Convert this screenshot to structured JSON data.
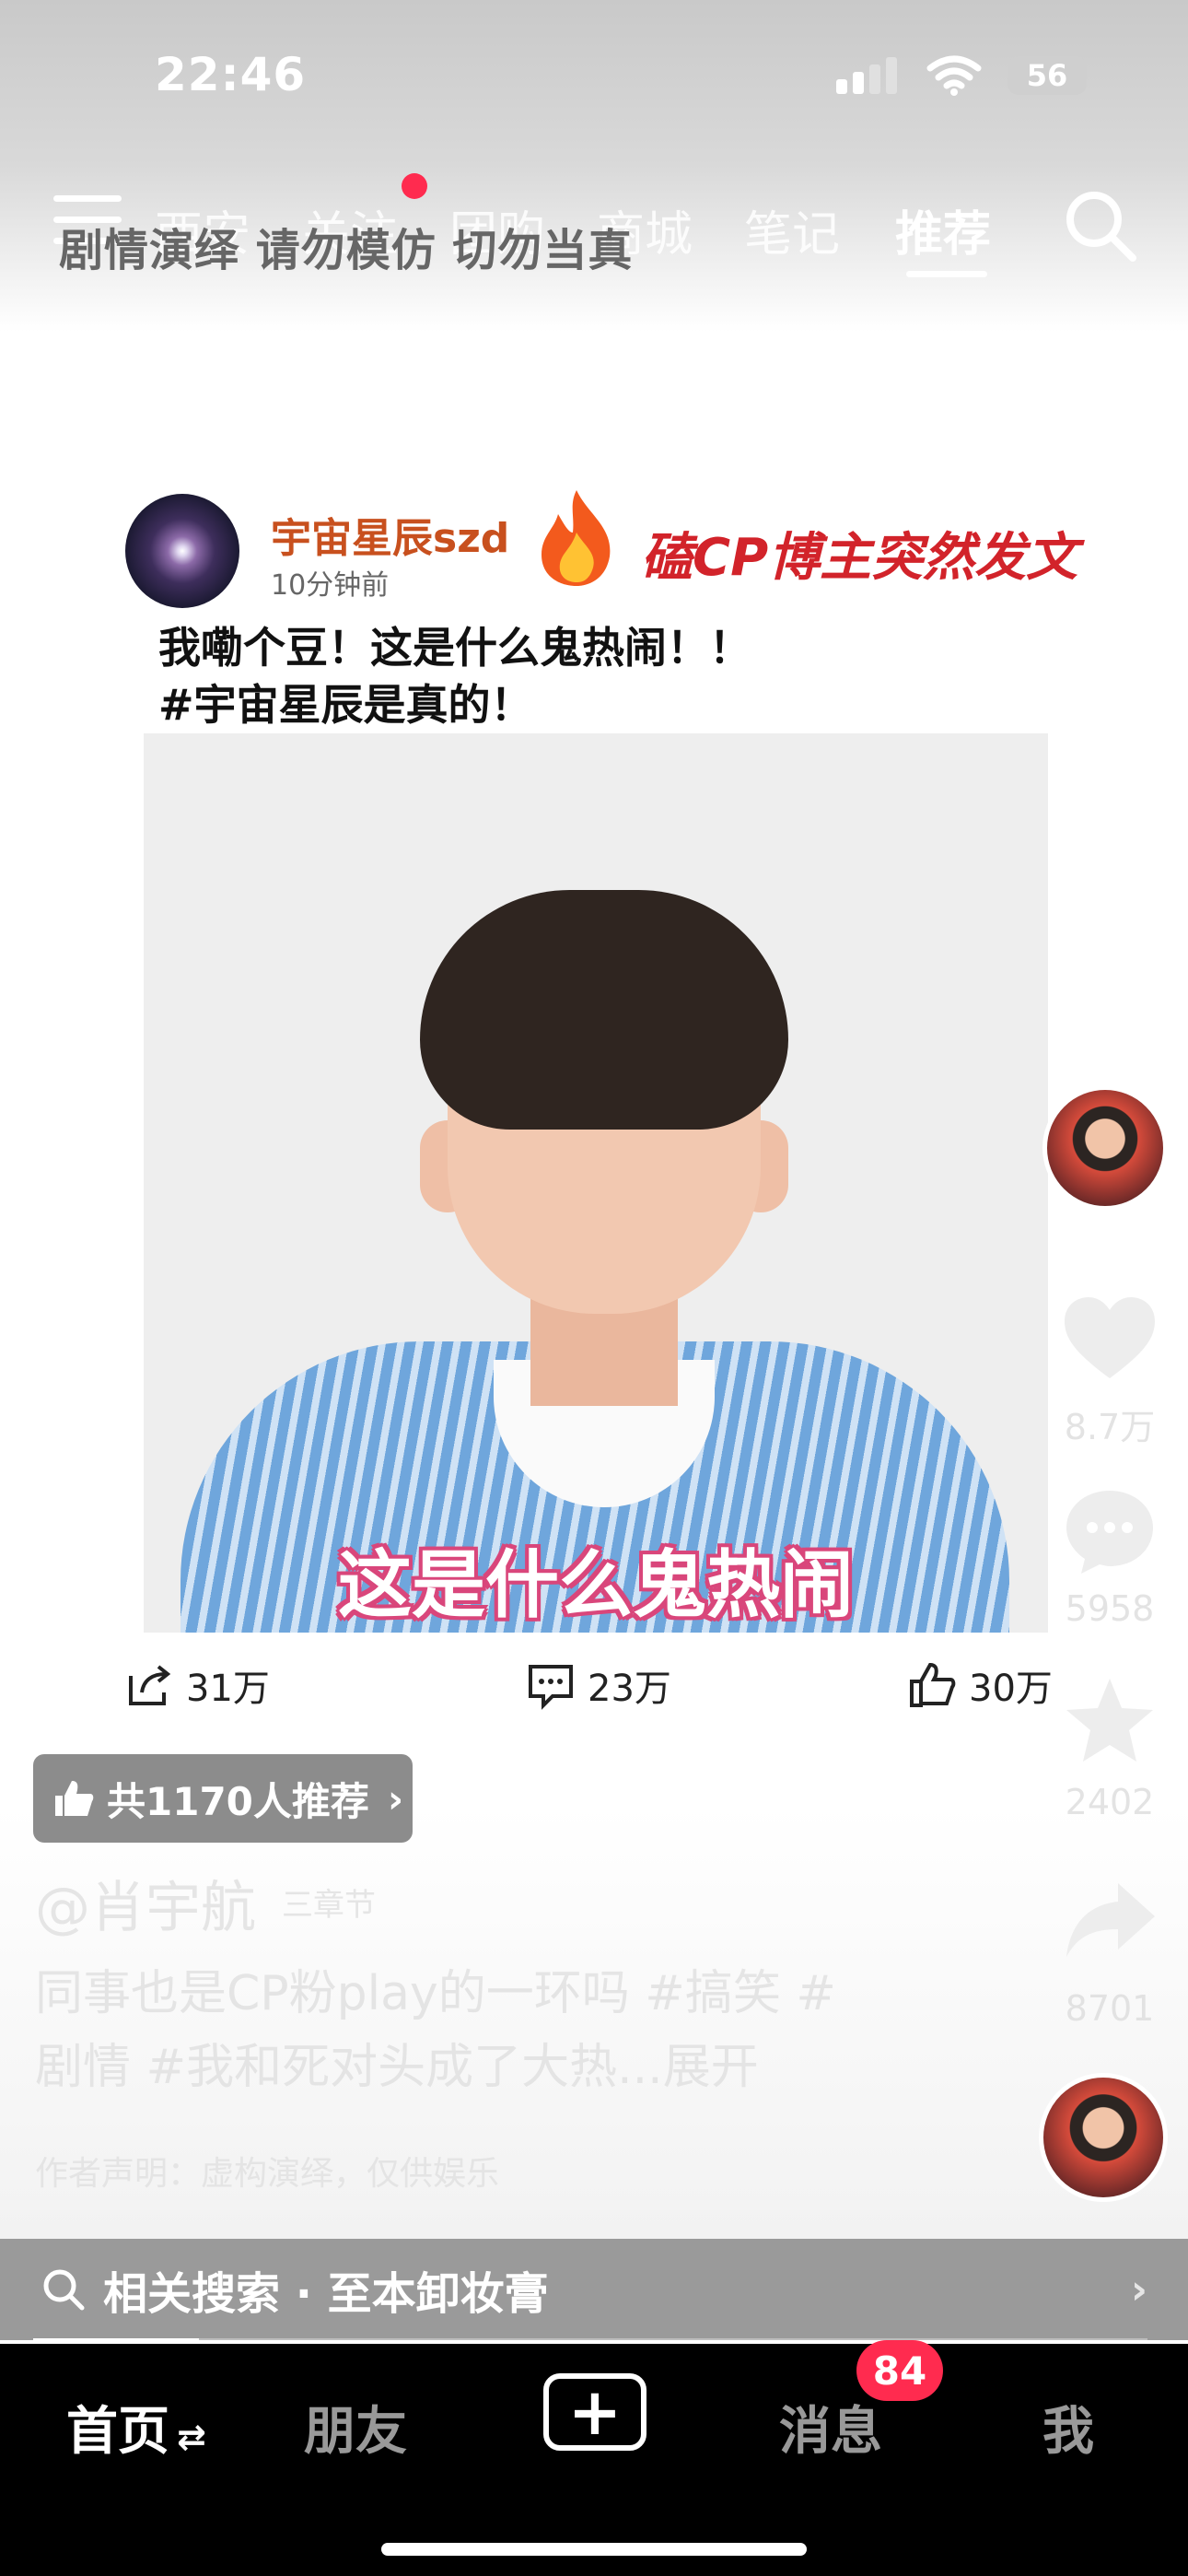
{
  "status_bar": {
    "time": "22:46",
    "battery": "56"
  },
  "top_nav": {
    "tabs": [
      "西安",
      "关注",
      "团购",
      "商城",
      "笔记",
      "推荐"
    ],
    "active_tab": "推荐",
    "overlay_caption": "剧情演绎 请勿模仿 切勿当真"
  },
  "post": {
    "username": "宇宙星辰szd",
    "time_ago": "10分钟前",
    "headline": "磕CP博主突然发文",
    "text_line1": "我嘞个豆！这是什么鬼热闹！！",
    "text_line2": "#宇宙星辰是真的！",
    "photo_caption": "这是什么鬼热闹",
    "shares": "31万",
    "comments": "23万",
    "likes": "30万"
  },
  "recommend": {
    "label": "共1170人推荐"
  },
  "video": {
    "author": "@肖宇航",
    "chapter": "三章节",
    "description_line1": "同事也是CP粉play的一环吗 #搞笑 #",
    "description_line2": "剧情 #我和死对头成了大热...展开",
    "disclaimer": "作者声明：虚构演绎，仅供娱乐"
  },
  "actions": {
    "likes": "8.7万",
    "comments": "5958",
    "favorites": "2402",
    "shares": "8701"
  },
  "related_search": {
    "label": "相关搜索 · 至本卸妆膏"
  },
  "bottom_nav": {
    "home": "首页",
    "friends": "朋友",
    "messages": "消息",
    "messages_badge": "84",
    "me": "我"
  },
  "colors": {
    "accent_red": "#ff2b4f",
    "username_orange": "#c8501e",
    "headline_red": "#d2232a"
  }
}
